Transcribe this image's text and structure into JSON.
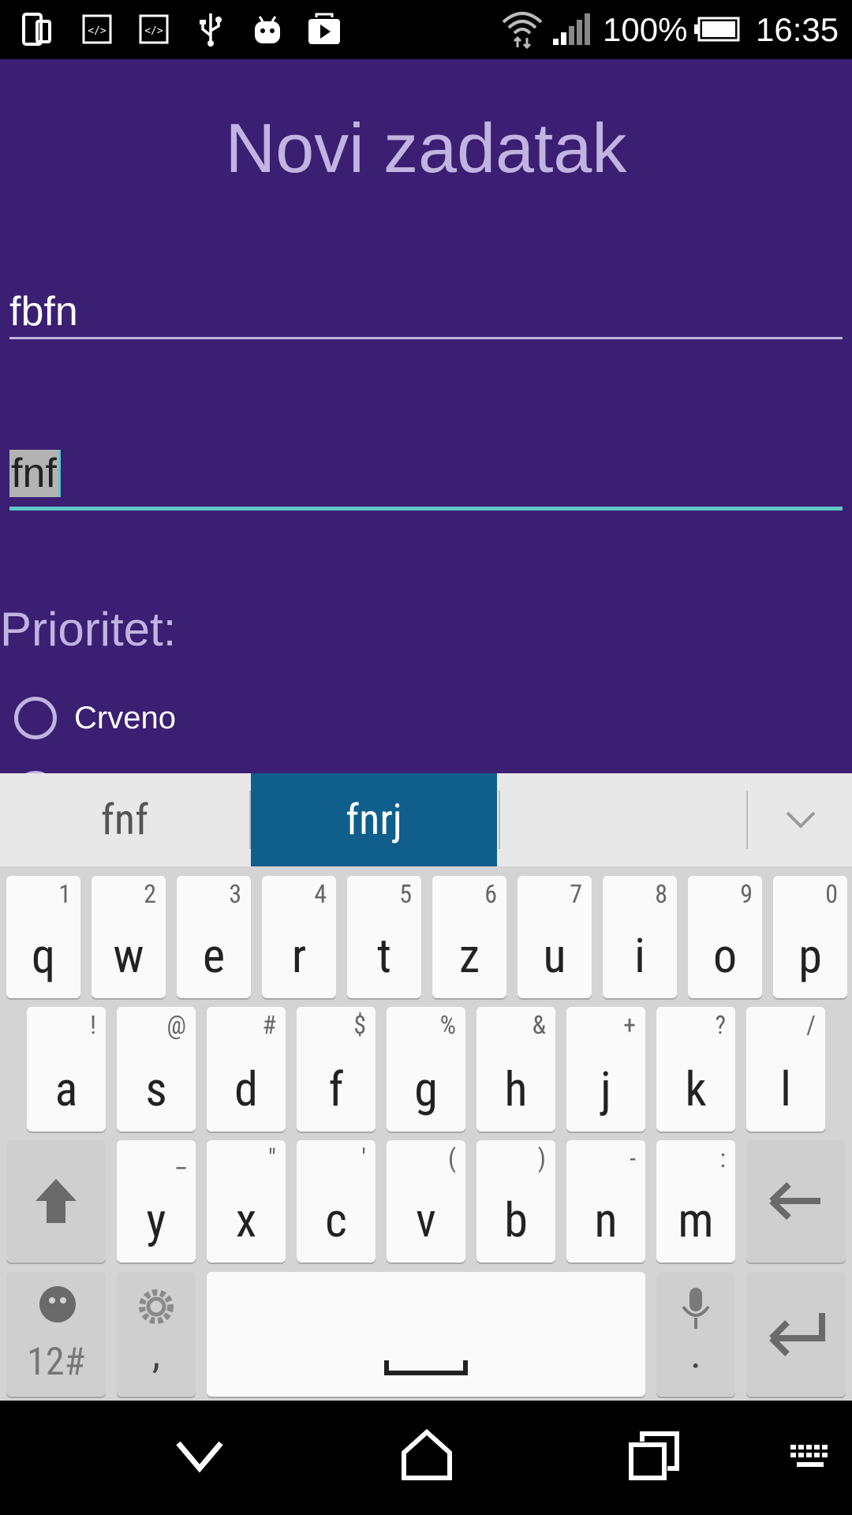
{
  "status_bar": {
    "battery_percent": "100%",
    "time": "16:35"
  },
  "app": {
    "title": "Novi zadatak",
    "field1_value": "fbfn",
    "field2_value": "fnf",
    "priority_label": "Prioritet:",
    "radio_options": [
      "Crveno"
    ],
    "colors": {
      "background": "#3a1f72",
      "accent": "#5fc7c7",
      "title": "#c2b3e0"
    }
  },
  "keyboard": {
    "suggestions": [
      "fnf",
      "fnrj"
    ],
    "selected_suggestion": "fnrj",
    "row1": [
      {
        "key": "q",
        "hint": "1"
      },
      {
        "key": "w",
        "hint": "2"
      },
      {
        "key": "e",
        "hint": "3"
      },
      {
        "key": "r",
        "hint": "4"
      },
      {
        "key": "t",
        "hint": "5"
      },
      {
        "key": "z",
        "hint": "6"
      },
      {
        "key": "u",
        "hint": "7"
      },
      {
        "key": "i",
        "hint": "8"
      },
      {
        "key": "o",
        "hint": "9"
      },
      {
        "key": "p",
        "hint": "0"
      }
    ],
    "row2": [
      {
        "key": "a",
        "hint": "!"
      },
      {
        "key": "s",
        "hint": "@"
      },
      {
        "key": "d",
        "hint": "#"
      },
      {
        "key": "f",
        "hint": "$"
      },
      {
        "key": "g",
        "hint": "%"
      },
      {
        "key": "h",
        "hint": "&"
      },
      {
        "key": "j",
        "hint": "+"
      },
      {
        "key": "k",
        "hint": "?"
      },
      {
        "key": "l",
        "hint": "/"
      }
    ],
    "row3": [
      {
        "key": "y",
        "hint": "_"
      },
      {
        "key": "x",
        "hint": "\""
      },
      {
        "key": "c",
        "hint": "'"
      },
      {
        "key": "v",
        "hint": "("
      },
      {
        "key": "b",
        "hint": ")"
      },
      {
        "key": "n",
        "hint": "-"
      },
      {
        "key": "m",
        "hint": ":"
      }
    ],
    "symbols_label": "12#",
    "comma_label": ",",
    "period_label": "."
  }
}
